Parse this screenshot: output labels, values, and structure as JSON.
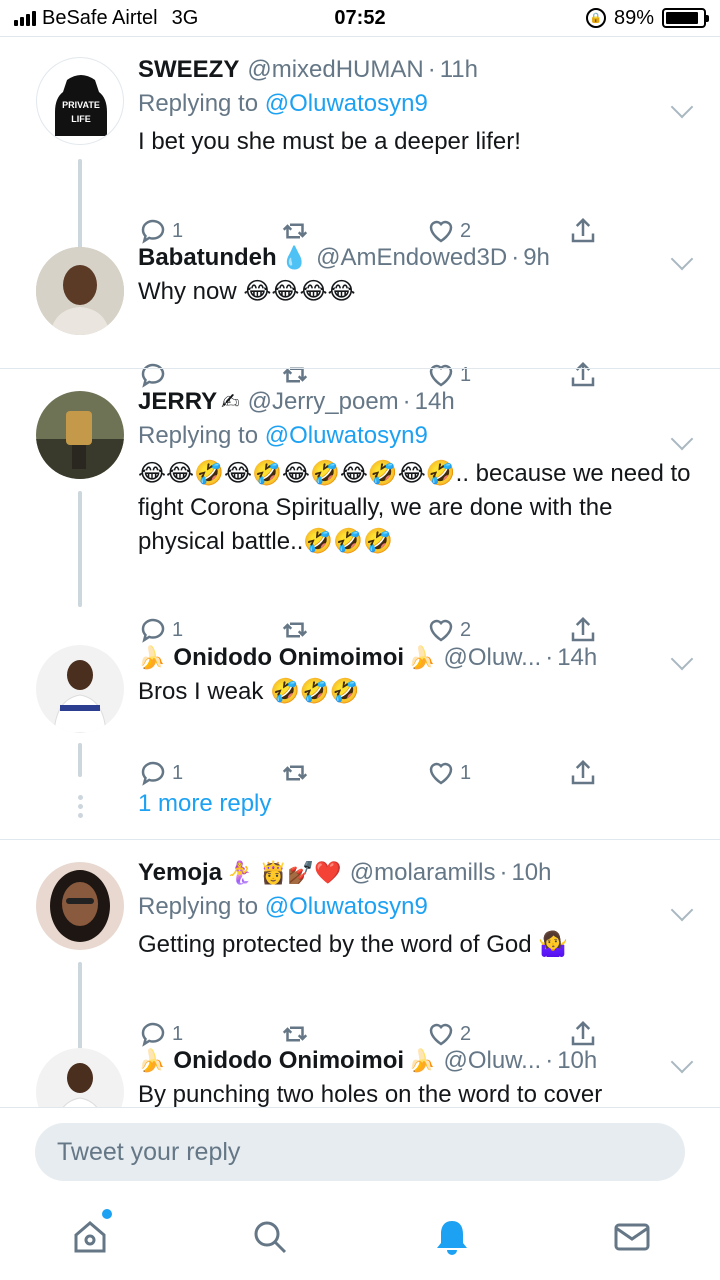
{
  "status_bar": {
    "carrier": "BeSafe Airtel",
    "network": "3G",
    "time": "07:52",
    "battery": "89%",
    "battery_level": 0.89
  },
  "colors": {
    "accent": "#1da1f2",
    "muted": "#657786",
    "text": "#14171a",
    "divider": "#e1e8ed"
  },
  "tweets": [
    {
      "name": "SWEEZY",
      "name_emoji": "",
      "handle": "@mixedHUMAN",
      "time": "11h",
      "replying_prefix": "Replying to",
      "replying_to": "@Oluwatosyn9",
      "text": "I bet you she must be a deeper lifer!",
      "replies": "1",
      "retweets": "",
      "likes": "2",
      "avatar_text": "PRIVATE LIFE"
    },
    {
      "name": "Babatundeh",
      "name_emoji": "💧",
      "handle": "@AmEndowed3D",
      "time": "9h",
      "text": "Why now 😂😂😂😂",
      "replies": "",
      "retweets": "",
      "likes": "1"
    },
    {
      "name": "JERRY",
      "name_emoji": "✍",
      "handle": "@Jerry_poem",
      "time": "14h",
      "replying_prefix": "Replying to",
      "replying_to": "@Oluwatosyn9",
      "text": "😂😂🤣😂🤣😂🤣😂🤣😂🤣.. because we need to fight Corona Spiritually, we are done with the physical battle..🤣🤣🤣",
      "replies": "1",
      "retweets": "",
      "likes": "2"
    },
    {
      "name_prefix_emoji": "🍌",
      "name": "Onidodo Onimoimoi",
      "name_emoji": "🍌",
      "handle": "@Oluw...",
      "time": "14h",
      "text": "Bros I weak 🤣🤣🤣",
      "replies": "1",
      "retweets": "",
      "likes": "1"
    },
    {
      "name": "Yemoja",
      "name_emoji": "🧜‍♀️ 👸💅🏾❤️",
      "handle": "@molaramills",
      "time": "10h",
      "replying_prefix": "Replying to",
      "replying_to": "@Oluwatosyn9",
      "text": "Getting protected by the word of God 🤷‍♀️",
      "replies": "1",
      "retweets": "",
      "likes": "2"
    },
    {
      "name_prefix_emoji": "🍌",
      "name": "Onidodo Onimoimoi",
      "name_emoji": "🍌",
      "handle": "@Oluw...",
      "time": "10h",
      "text": "By punching two holes on the word to cover"
    }
  ],
  "more_replies_label": "1 more reply",
  "reply_bar": {
    "placeholder": "Tweet your reply"
  },
  "nav": {
    "icons": [
      "home-icon",
      "search-icon",
      "notifications-icon",
      "messages-icon"
    ]
  }
}
